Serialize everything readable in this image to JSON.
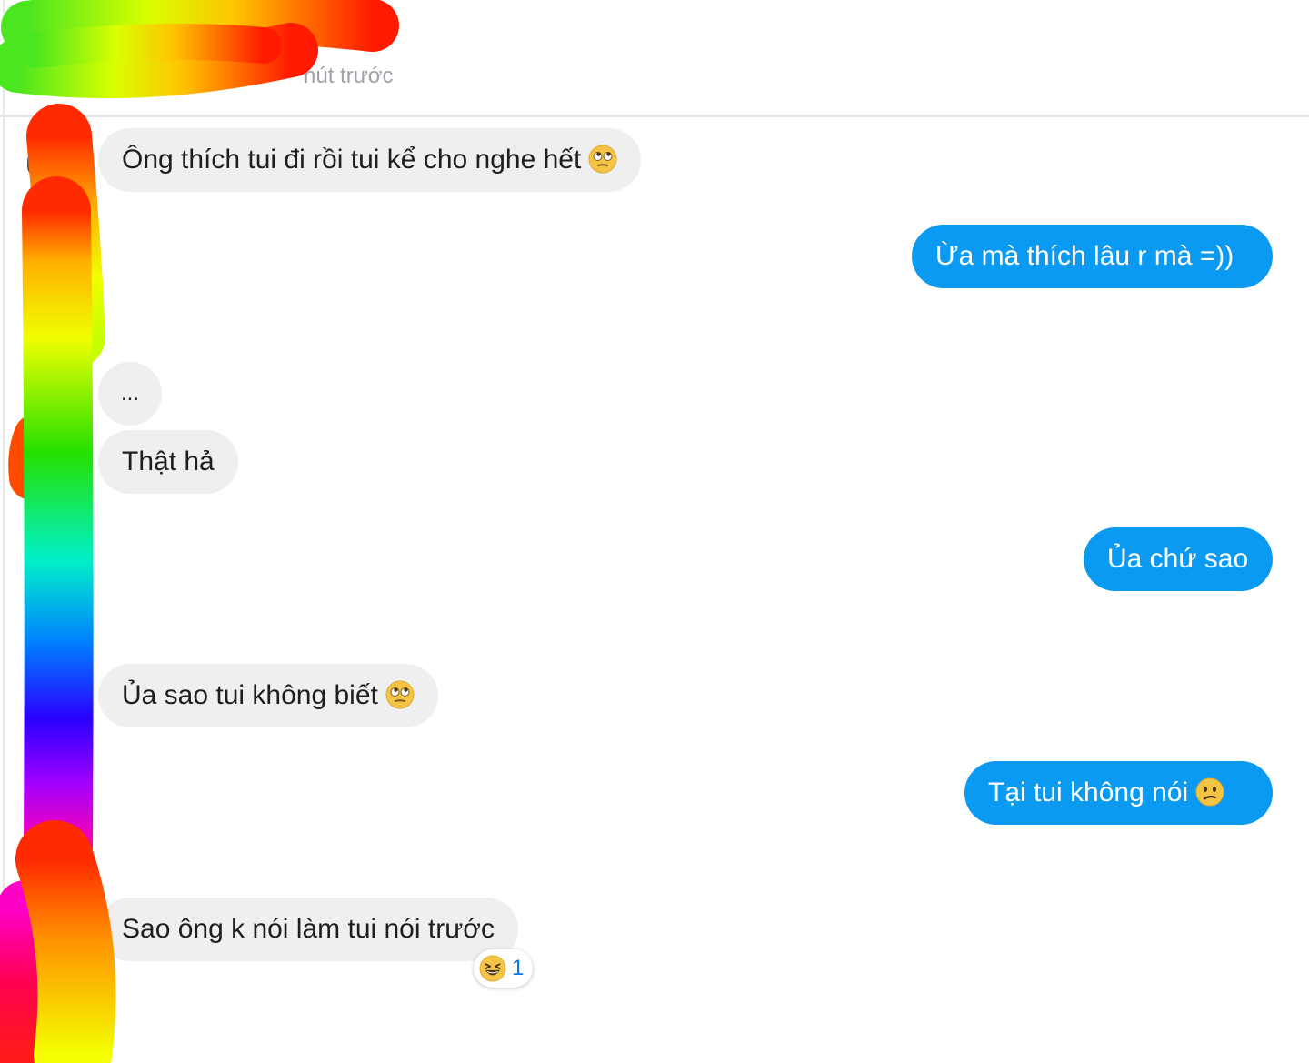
{
  "header": {
    "name": "",
    "status": "hút trước"
  },
  "messages": [
    {
      "direction": "in",
      "text": "Ông thích tui đi rồi tui kể cho nghe hết",
      "emoji": "face-with-rolling-eyes-emoji"
    },
    {
      "direction": "out",
      "text": "Ừa mà thích lâu r mà =))"
    },
    {
      "direction": "in",
      "text": "..."
    },
    {
      "direction": "in",
      "text": "Thật hả"
    },
    {
      "direction": "out",
      "text": "Ủa chứ sao"
    },
    {
      "direction": "in",
      "text": "Ủa sao tui không biết",
      "emoji": "face-with-rolling-eyes-emoji"
    },
    {
      "direction": "out",
      "text": "Tại tui không nói",
      "emoji": "confused-face-emoji"
    },
    {
      "direction": "in",
      "text": "Sao ông k nói làm tui nói trước"
    }
  ],
  "reaction": {
    "icon": "grinning-squinting-face-emoji",
    "count": "1"
  },
  "colors": {
    "outgoing_bubble": "#0a9af2",
    "incoming_bubble": "#efefef",
    "divider": "#e4e6eb"
  }
}
